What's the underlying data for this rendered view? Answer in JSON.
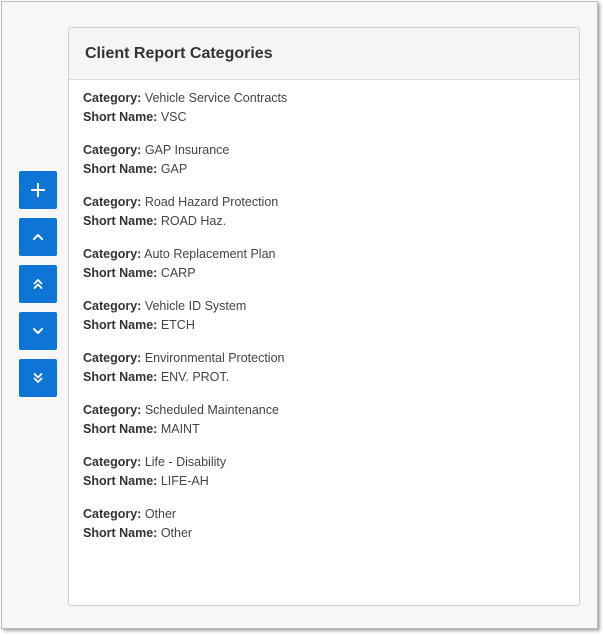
{
  "panel": {
    "title": "Client Report Categories"
  },
  "labels": {
    "category": "Category:",
    "short_name": "Short Name:"
  },
  "toolbar": {
    "buttons": [
      {
        "name": "add-button",
        "icon": "plus-icon"
      },
      {
        "name": "move-up-button",
        "icon": "chevron-up-icon"
      },
      {
        "name": "move-to-top-button",
        "icon": "double-chevron-up-icon"
      },
      {
        "name": "move-down-button",
        "icon": "chevron-down-icon"
      },
      {
        "name": "move-to-bottom-button",
        "icon": "double-chevron-down-icon"
      }
    ],
    "color": "#0e74d6"
  },
  "categories": [
    {
      "category": "Vehicle Service Contracts",
      "short_name": "VSC"
    },
    {
      "category": "GAP Insurance",
      "short_name": "GAP"
    },
    {
      "category": "Road Hazard Protection",
      "short_name": "ROAD Haz."
    },
    {
      "category": "Auto Replacement Plan",
      "short_name": "CARP"
    },
    {
      "category": "Vehicle ID System",
      "short_name": "ETCH"
    },
    {
      "category": "Environmental Protection",
      "short_name": "ENV. PROT."
    },
    {
      "category": "Scheduled Maintenance",
      "short_name": "MAINT"
    },
    {
      "category": "Life - Disability",
      "short_name": "LIFE-AH"
    },
    {
      "category": "Other",
      "short_name": "Other"
    }
  ]
}
